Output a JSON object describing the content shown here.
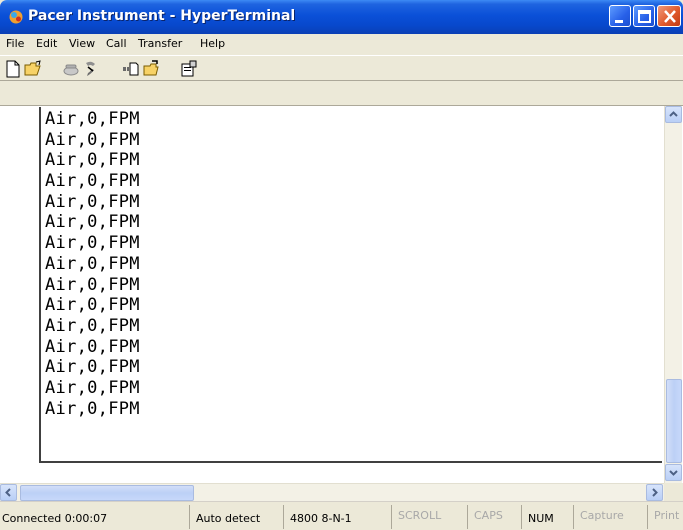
{
  "window": {
    "title": "Pacer Instrument - HyperTerminal"
  },
  "menu": {
    "items": [
      "File",
      "Edit",
      "View",
      "Call",
      "Transfer",
      "Help"
    ]
  },
  "toolbar": {
    "icons": [
      "new-document-icon",
      "open-folder-icon",
      "connect-phone-icon",
      "disconnect-phone-icon",
      "send-icon",
      "receive-icon",
      "properties-icon"
    ]
  },
  "terminal": {
    "lines": [
      "Air,0,FPM",
      "Air,0,FPM",
      "Air,0,FPM",
      "Air,0,FPM",
      "Air,0,FPM",
      "Air,0,FPM",
      "Air,0,FPM",
      "Air,0,FPM",
      "Air,0,FPM",
      "Air,0,FPM",
      "Air,0,FPM",
      "Air,0,FPM",
      "Air,0,FPM",
      "Air,0,FPM",
      "Air,0,FPM"
    ]
  },
  "status": {
    "connected": "Connected 0:00:07",
    "detect": "Auto detect",
    "settings": "4800 8-N-1",
    "scroll": "SCROLL",
    "caps": "CAPS",
    "num": "NUM",
    "capture": "Capture",
    "print": "Print echo"
  },
  "colors": {
    "titlebar": "#0a50d8",
    "chrome": "#ece9d8",
    "close_button": "#e05a2c"
  }
}
